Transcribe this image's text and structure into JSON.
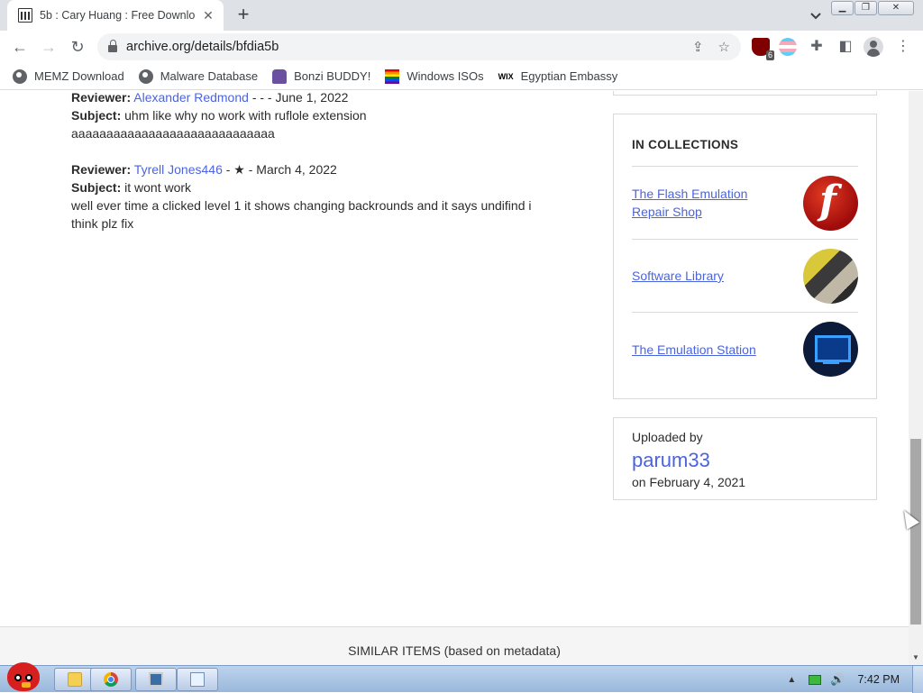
{
  "browser": {
    "tab": {
      "title": "5b : Cary Huang : Free Downlo"
    },
    "url": "archive.org/details/bfdia5b",
    "extension_badge": "6",
    "bookmarks": [
      {
        "label": "MEMZ Download",
        "icon": "globe-icon"
      },
      {
        "label": "Malware Database",
        "icon": "globe-icon"
      },
      {
        "label": "Bonzi BUDDY!",
        "icon": "bonzi-icon"
      },
      {
        "label": "Windows ISOs",
        "icon": "rainbow-flag-icon"
      },
      {
        "label": "Egyptian Embassy",
        "icon": "wix-icon"
      }
    ]
  },
  "reviews": [
    {
      "reviewer_label": "Reviewer:",
      "reviewer": "Alexander Redmond",
      "rating": "- -",
      "date": "- June 1, 2022",
      "subject_label": "Subject:",
      "subject": "uhm like why no work with ruflole extension",
      "body": "aaaaaaaaaaaaaaaaaaaaaaaaaaaaa"
    },
    {
      "reviewer_label": "Reviewer:",
      "reviewer": "Tyrell Jones446",
      "rating": "- ★",
      "date": "- March 4, 2022",
      "subject_label": "Subject:",
      "subject": "it wont work",
      "body": "well ever time a clicked level 1 it shows changing backrounds and it says undifind i think plz fix"
    }
  ],
  "collections": {
    "heading": "IN COLLECTIONS",
    "items": [
      {
        "name": "The Flash Emulation Repair Shop",
        "thumb": "flash-logo-icon"
      },
      {
        "name": "Software Library",
        "thumb": "software-library-icon"
      },
      {
        "name": "The Emulation Station",
        "thumb": "emulation-station-icon"
      }
    ]
  },
  "uploader": {
    "label": "Uploaded by",
    "name": "parum33",
    "date": "on February 4, 2021"
  },
  "similar_items": "SIMILAR ITEMS (based on metadata)",
  "taskbar": {
    "clock": "7:42 PM"
  },
  "colors": {
    "link": "#4b64de",
    "border": "#d9d9d9",
    "tabstrip": "#dee1e6"
  }
}
